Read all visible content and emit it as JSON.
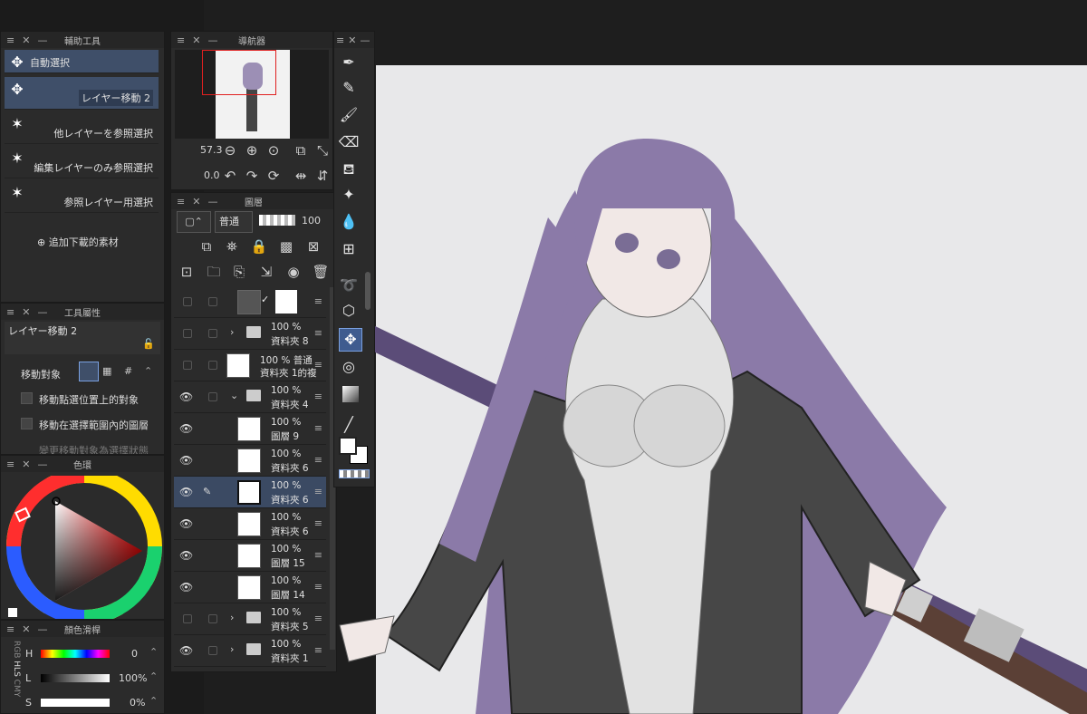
{
  "subtool_panel": {
    "title": "輔助工具",
    "items": [
      {
        "label": "自動選択"
      },
      {
        "label": "レイヤー移動 2"
      },
      {
        "label": "他レイヤーを参照選択"
      },
      {
        "label": "編集レイヤーのみ参照選択"
      },
      {
        "label": "参照レイヤー用選択"
      }
    ],
    "add_material": "追加下載的素材"
  },
  "tool_property": {
    "title": "工具屬性",
    "tool_name": "レイヤー移動 2",
    "move_target_label": "移動對象",
    "option1": "移動點選位置上的對象",
    "option2": "移動在選擇範圍內的圖層",
    "option3": "變更移動對象為選擇狀態"
  },
  "color_wheel": {
    "title": "色環"
  },
  "color_slider": {
    "title": "顏色滑桿",
    "modes": [
      "RGB",
      "HLS",
      "CMY"
    ],
    "h_label": "H",
    "h_value": "0",
    "l_label": "L",
    "l_value": "100%",
    "s_label": "S",
    "s_value": "0%"
  },
  "navigator": {
    "title": "導航器",
    "zoom": "57.3",
    "rotation": "0.0"
  },
  "layer_panel": {
    "title": "圖層",
    "blend_mode": "普通",
    "opacity": "100",
    "layers": [
      {
        "pct": "",
        "name": "",
        "visible": false,
        "type": "paper"
      },
      {
        "pct": "100 %",
        "name": "資料夾 8",
        "visible": false,
        "type": "folder"
      },
      {
        "pct": "100 % 普通",
        "name": "資料夾 1的複",
        "visible": false,
        "type": "image"
      },
      {
        "pct": "100 %",
        "name": "資料夾 4",
        "visible": true,
        "type": "folder-open"
      },
      {
        "pct": "100 %",
        "name": "圖層 9",
        "visible": true,
        "type": "raster"
      },
      {
        "pct": "100 %",
        "name": "資料夾 6",
        "visible": true,
        "type": "raster"
      },
      {
        "pct": "100 %",
        "name": "資料夾 6",
        "visible": true,
        "type": "raster-sel"
      },
      {
        "pct": "100 %",
        "name": "資料夾 6",
        "visible": true,
        "type": "raster"
      },
      {
        "pct": "100 %",
        "name": "圖層 15",
        "visible": true,
        "type": "raster"
      },
      {
        "pct": "100 %",
        "name": "圖層 14",
        "visible": true,
        "type": "raster"
      },
      {
        "pct": "100 %",
        "name": "資料夾 5",
        "visible": false,
        "type": "folder"
      },
      {
        "pct": "100 %",
        "name": "資料夾 1",
        "visible": true,
        "type": "folder"
      }
    ]
  },
  "colors": {
    "accent": "#3f4f69",
    "hair": "#8b7aa8",
    "coat": "#474747",
    "staff": "#5b4036",
    "canvas_bg": "#e8e8ea"
  }
}
